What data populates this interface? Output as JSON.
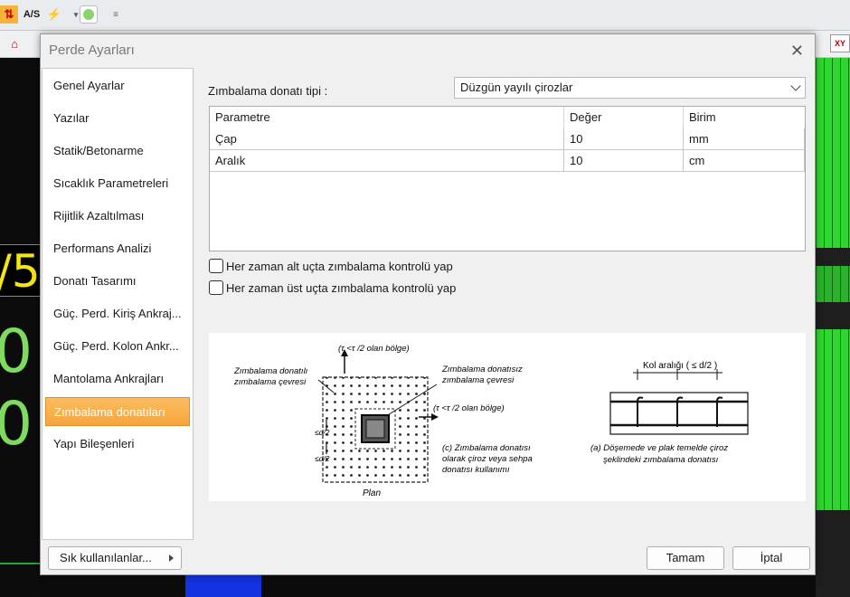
{
  "dialog": {
    "title": "Perde Ayarları",
    "nav": [
      "Genel Ayarlar",
      "Yazılar",
      "Statik/Betonarme",
      "Sıcaklık Parametreleri",
      "Rijitlik Azaltılması",
      "Performans Analizi",
      "Donatı Tasarımı",
      "Güç. Perd. Kiriş Ankraj...",
      "Güç. Perd. Kolon Ankr...",
      "Mantolama Ankrajları",
      "Zımbalama donatıları",
      "Yapı Bileşenleri"
    ],
    "active_nav": "Zımbalama donatıları",
    "punching_type_label": "Zımbalama donatı tipi :",
    "punching_type_value": "Düzgün yayılı çirozlar",
    "grid": {
      "columns": [
        "Parametre",
        "Değer",
        "Birim"
      ],
      "rows": [
        [
          "Çap",
          "10",
          "mm"
        ],
        [
          "Aralık",
          "10",
          "cm"
        ]
      ]
    },
    "checkboxes": [
      {
        "label": "Her zaman alt uçta zımbalama kontrolü yap",
        "checked": false
      },
      {
        "label": "Her zaman üst uçta zımbalama kontrolü yap",
        "checked": false
      }
    ],
    "figure": {
      "top_label": "(τ  <τ   /2 olan bölge)",
      "left_label_1": "Zımbalama donatılı",
      "left_label_2": "zımbalama çevresi",
      "mid_label_1": "Zımbalama donatısız",
      "mid_label_2": "zımbalama çevresi",
      "right_zone_label": "(τ  <τ   /2 olan bölge)",
      "d2_a": "≤d/2",
      "d2_b": "≤d/2",
      "caption_c_1": "(c) Zımbalama donatısı",
      "caption_c_2": "olarak çiroz veya sehpa",
      "caption_c_3": "donatısı kullanımı",
      "plan": "Plan",
      "kol_label": "Kol aralığı ( ≤ d/2 )",
      "caption_a_1": "(a) Döşemede ve plak temelde çiroz",
      "caption_a_2": "şeklindeki zımbalama donatısı"
    },
    "favorites_label": "Sık kullanılanlar...",
    "ok_label": "Tamam",
    "cancel_label": "İptal"
  },
  "background": {
    "yellow_text": "/5",
    "green_text_1": "0",
    "green_text_2": "0",
    "toolbar_as": "A/S"
  },
  "colors": {
    "active_nav": "#f5a53c",
    "mesh_green": "#2fd62f",
    "yellow": "#f5e60c"
  }
}
